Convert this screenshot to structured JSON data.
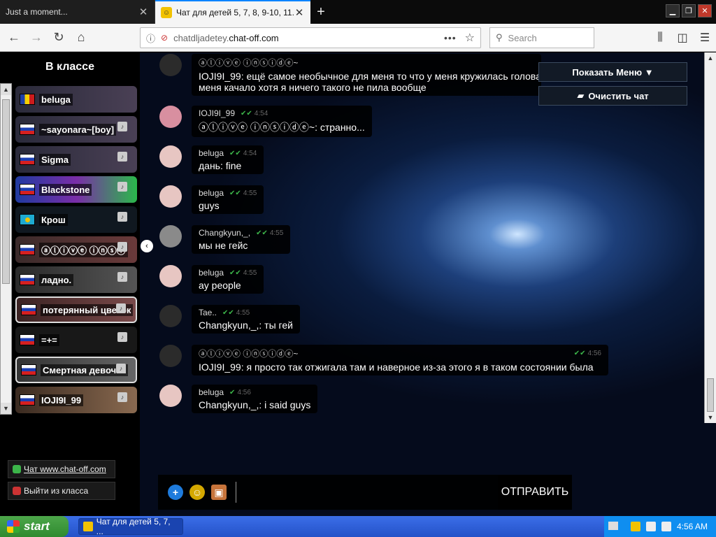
{
  "browser": {
    "tabs": [
      {
        "title": "Just a moment...",
        "active": false
      },
      {
        "title": "Чат для детей 5, 7, 8, 9-10, 11.",
        "active": true
      }
    ],
    "url_prefix": "chatdljadetey.",
    "url_domain": "chat-off.com",
    "search_placeholder": "Search"
  },
  "sidebar": {
    "title": "В классе",
    "users": [
      {
        "name": "beluga",
        "flag": "ro",
        "icon": false
      },
      {
        "name": "~sayonara~[boy]",
        "flag": "ru",
        "icon": true
      },
      {
        "name": "Sigma",
        "flag": "ru",
        "icon": true
      },
      {
        "name": "Blackstone",
        "flag": "ru",
        "icon": true
      },
      {
        "name": "Крош",
        "flag": "kz",
        "icon": true
      },
      {
        "name": "ⓐⓛⓘⓥⓔ ⓘⓝⓢⓘ",
        "flag": "ru",
        "icon": true
      },
      {
        "name": "ладно.",
        "flag": "ru",
        "icon": true
      },
      {
        "name": "потерянный цветок",
        "flag": "ru",
        "icon": true
      },
      {
        "name": "=+=",
        "flag": "ru",
        "icon": true
      },
      {
        "name": "Смертная девочка",
        "flag": "ru",
        "icon": true
      },
      {
        "name": "IOJI9I_99",
        "flag": "ru",
        "icon": true
      }
    ],
    "link_site": "Чат www.chat-off.com",
    "link_exit": "Выйти из класса"
  },
  "menu": {
    "show_menu": "Показать Меню ▼",
    "clear_chat": "Очистить чат"
  },
  "messages": [
    {
      "nick": "ⓐⓛⓘⓥⓔ ⓘⓝⓢⓘⓓⓔ~",
      "time": "",
      "text": "IOJI9I_99: ещё самое необычное для меня то что у меня кружилась голова",
      "text2": "меня качало хотя я ничего такого не пила вообще"
    },
    {
      "nick": "IOJI9I_99",
      "time": "4:54",
      "text": "ⓐⓛⓘⓥⓔ ⓘⓝⓢⓘⓓⓔ~: странно..."
    },
    {
      "nick": "beluga",
      "time": "4:54",
      "text": "дань: fine"
    },
    {
      "nick": "beluga",
      "time": "4:55",
      "text": "guys"
    },
    {
      "nick": "Changkyun,_,",
      "time": "4:55",
      "text": "мы не гейс"
    },
    {
      "nick": "beluga",
      "time": "4:55",
      "text": "ay people"
    },
    {
      "nick": "Tae..",
      "time": "4:55",
      "text": "Changkyun,_,: ты гей"
    },
    {
      "nick": "ⓐⓛⓘⓥⓔ ⓘⓝⓢⓘⓓⓔ~",
      "time": "4:56",
      "text": "IOJI9I_99: я просто так отжигала там и наверное из-за этого я в таком состоянии была"
    },
    {
      "nick": "beluga",
      "time": "4:56",
      "text": "Changkyun,_,: i said guys"
    }
  ],
  "input": {
    "send_label": "ОТПРАВИТЬ"
  },
  "taskbar": {
    "start": "start",
    "task_title": "Чат для детей 5, 7, ...",
    "clock": "4:56 AM"
  }
}
